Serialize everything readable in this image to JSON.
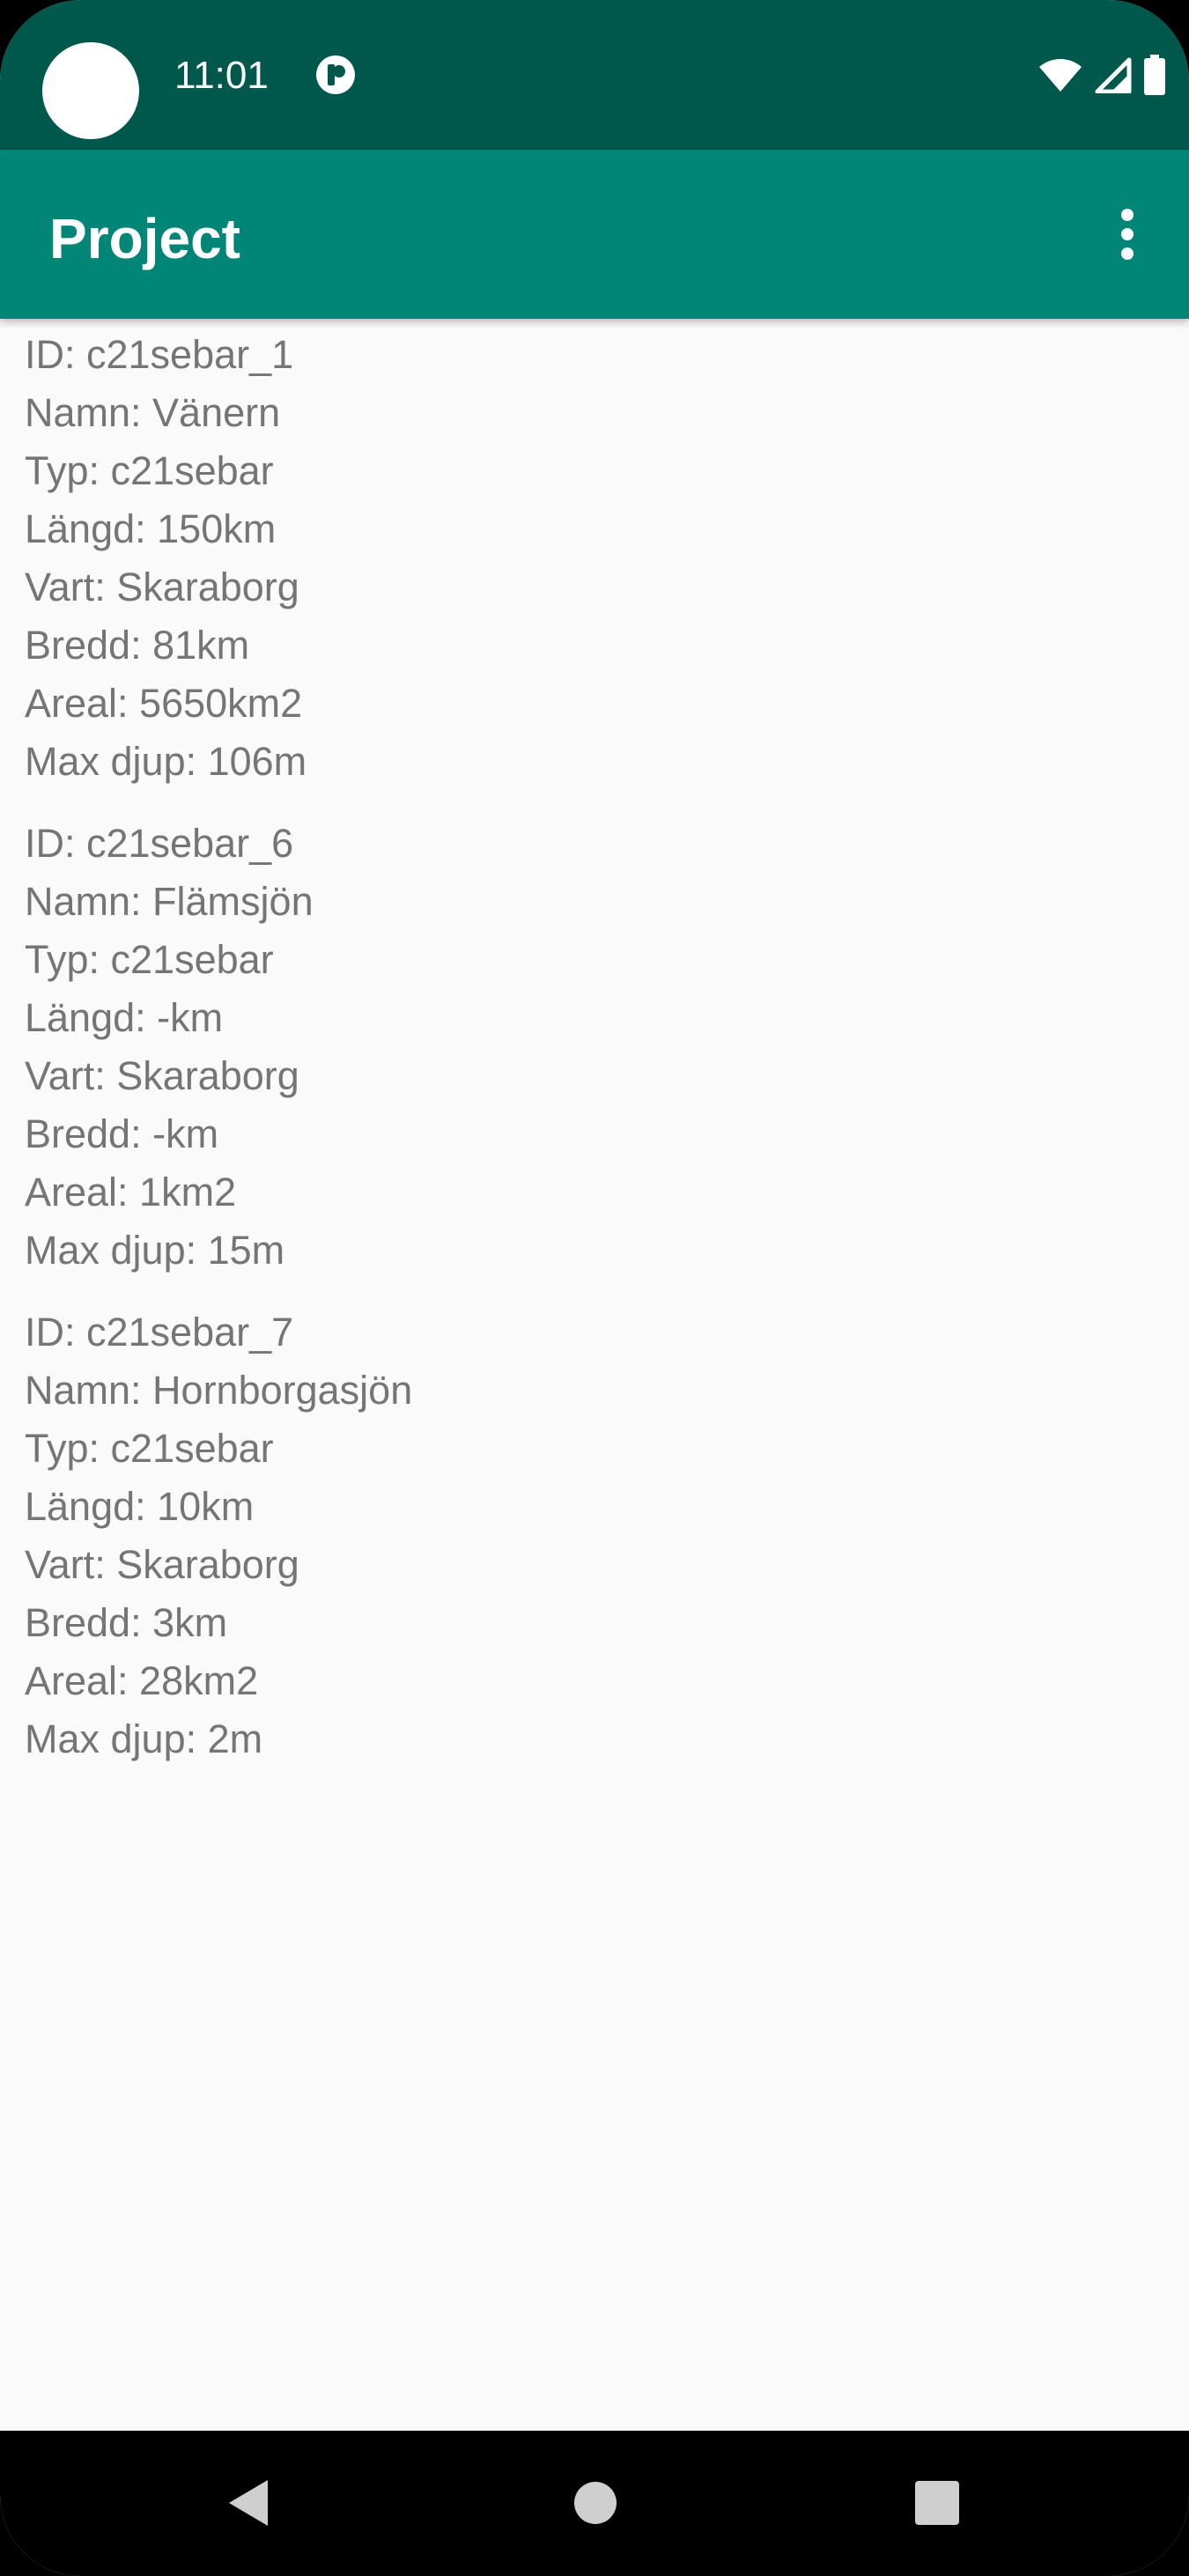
{
  "status_bar": {
    "time": "11:01",
    "icons": [
      "notification-app-icon",
      "wifi-icon",
      "signal-icon",
      "battery-icon"
    ]
  },
  "app_bar": {
    "title": "Project",
    "menu_icon": "more-vert-icon"
  },
  "lakes": [
    {
      "id": "ID: c21sebar_1",
      "name": "Namn: Vänern",
      "type": "Typ: c21sebar",
      "length": "Längd: 150km",
      "location": "Vart: Skaraborg",
      "width": "Bredd: 81km",
      "area": "Areal: 5650km2",
      "max_depth": "Max djup: 106m"
    },
    {
      "id": "ID: c21sebar_6",
      "name": "Namn: Flämsjön",
      "type": "Typ: c21sebar",
      "length": "Längd: -km",
      "location": "Vart: Skaraborg",
      "width": "Bredd: -km",
      "area": "Areal: 1km2",
      "max_depth": "Max djup: 15m"
    },
    {
      "id": "ID: c21sebar_7",
      "name": "Namn: Hornborgasjön",
      "type": "Typ: c21sebar",
      "length": "Längd: 10km",
      "location": "Vart: Skaraborg",
      "width": "Bredd: 3km",
      "area": "Areal: 28km2",
      "max_depth": "Max djup: 2m"
    }
  ],
  "nav_bar": {
    "icons": [
      "back-icon",
      "home-icon",
      "recents-icon"
    ]
  },
  "colors": {
    "status_bar": "#00574b",
    "app_bar": "#008577",
    "background": "#fafafa",
    "text": "#757575"
  }
}
